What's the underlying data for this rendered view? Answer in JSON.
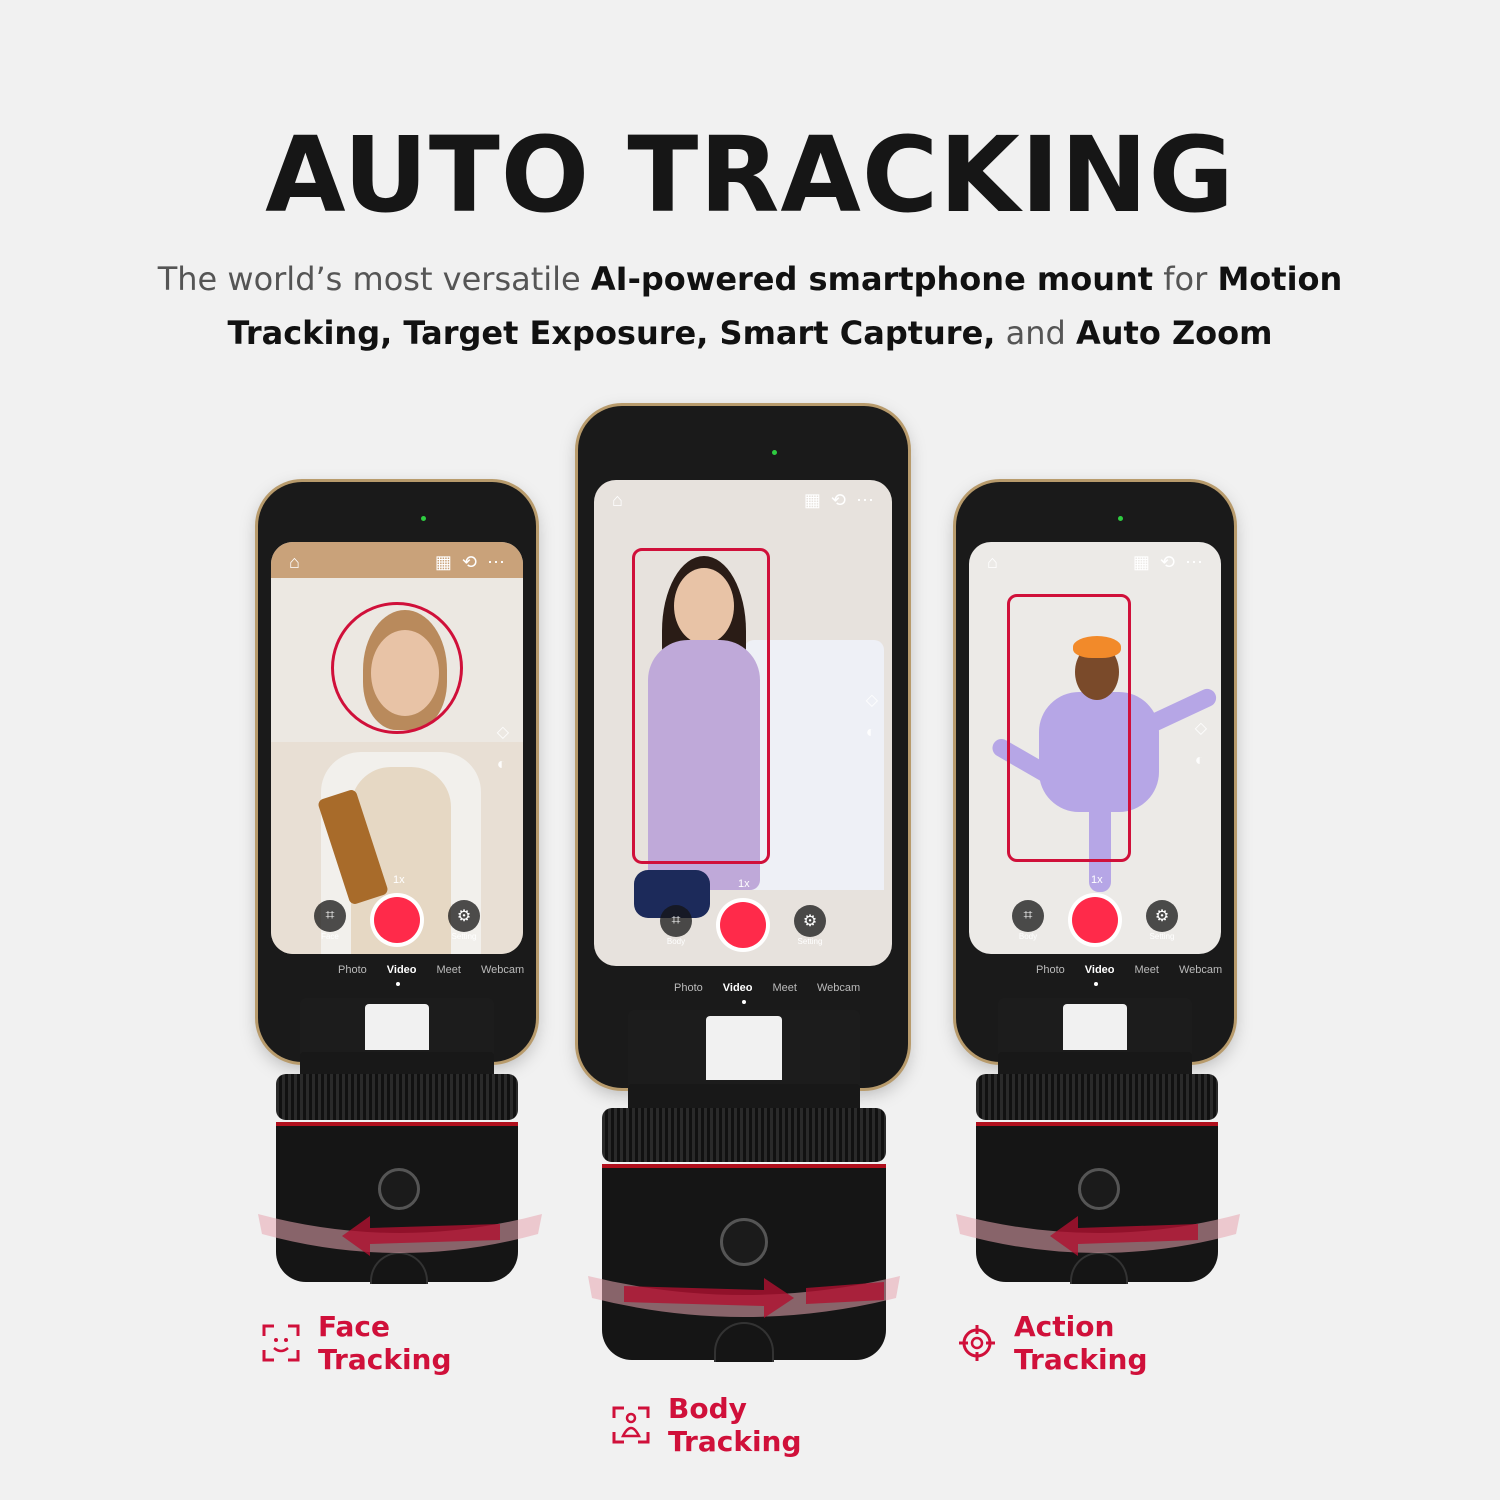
{
  "header": {
    "title": "AUTO TRACKING",
    "subtitle_parts": [
      {
        "text": "The world’s most versatile ",
        "bold": false
      },
      {
        "text": "AI-powered smartphone mount",
        "bold": true
      },
      {
        "text": " for ",
        "bold": false
      },
      {
        "text": "Motion Tracking, Target Exposure, Smart Capture,",
        "bold": true
      },
      {
        "text": " and ",
        "bold": false
      },
      {
        "text": "Auto Zoom",
        "bold": true
      }
    ]
  },
  "accent_color": "#d0103a",
  "devices": [
    {
      "id": "left",
      "zoom": "1x",
      "buttons": [
        "Face",
        "Setting"
      ],
      "modes": [
        "Photo",
        "Video",
        "Meet",
        "Webcam"
      ],
      "active_mode": "Video",
      "feature_label": "Face Tracking",
      "feature_icon": "face-scan-icon",
      "rotation_direction": "left"
    },
    {
      "id": "center",
      "zoom": "1x",
      "buttons": [
        "Body",
        "Setting"
      ],
      "modes": [
        "Photo",
        "Video",
        "Meet",
        "Webcam"
      ],
      "active_mode": "Video",
      "feature_label": "Body Tracking",
      "feature_icon": "body-scan-icon",
      "rotation_direction": "right"
    },
    {
      "id": "right",
      "zoom": "1x",
      "buttons": [
        "Body",
        "Setting"
      ],
      "modes": [
        "Photo",
        "Video",
        "Meet",
        "Webcam"
      ],
      "active_mode": "Video",
      "feature_label": "Action Tracking",
      "feature_icon": "crosshair-icon",
      "rotation_direction": "left"
    }
  ]
}
